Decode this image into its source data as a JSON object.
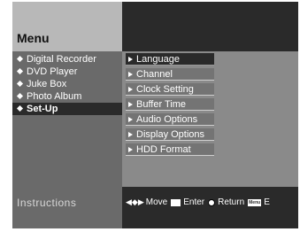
{
  "menu": {
    "title": "Menu",
    "main_items": [
      {
        "label": "Digital Recorder"
      },
      {
        "label": "DVD Player"
      },
      {
        "label": "Juke Box"
      },
      {
        "label": "Photo Album"
      },
      {
        "label": "Set-Up",
        "selected": true
      }
    ],
    "sub_items": [
      {
        "label": "Language",
        "selected": true
      },
      {
        "label": "Channel"
      },
      {
        "label": "Clock Setting"
      },
      {
        "label": "Buffer Time"
      },
      {
        "label": "Audio Options"
      },
      {
        "label": "Display Options"
      },
      {
        "label": "HDD Format"
      }
    ]
  },
  "instructions": {
    "label": "Instructions",
    "move": "Move",
    "enter": "Enter",
    "return": "Return",
    "menu_key": "Menu",
    "trailing": "E"
  }
}
